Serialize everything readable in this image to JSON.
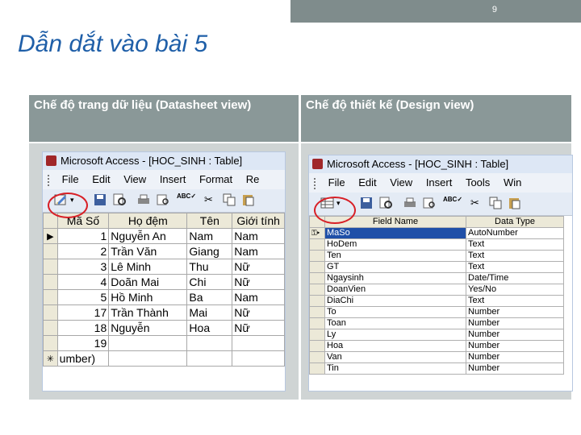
{
  "slide": {
    "number": "9",
    "title": "Dẫn dắt vào bài 5"
  },
  "columns": {
    "left_header": "Chế độ trang dữ liệu (Datasheet view)",
    "right_header": "Chế độ thiết kế (Design view)"
  },
  "datasheet_window": {
    "title": "Microsoft Access - [HOC_SINH : Table]",
    "menu": [
      "File",
      "Edit",
      "View",
      "Insert",
      "Format",
      "Re"
    ],
    "headers": [
      "Mã Số",
      "Họ đệm",
      "Tên",
      "Giới tính"
    ],
    "rows": [
      {
        "sel": "▶",
        "id": "1",
        "ho_dem": "Nguyễn An",
        "ten": "Nam",
        "gioi_tinh": "Nam"
      },
      {
        "sel": "",
        "id": "2",
        "ho_dem": "Trần Văn",
        "ten": "Giang",
        "gioi_tinh": "Nam"
      },
      {
        "sel": "",
        "id": "3",
        "ho_dem": "Lê Minh",
        "ten": "Thu",
        "gioi_tinh": "Nữ"
      },
      {
        "sel": "",
        "id": "4",
        "ho_dem": "Doãn Mai",
        "ten": "Chi",
        "gioi_tinh": "Nữ"
      },
      {
        "sel": "",
        "id": "5",
        "ho_dem": "Hồ Minh",
        "ten": "Ba",
        "gioi_tinh": "Nam"
      },
      {
        "sel": "",
        "id": "17",
        "ho_dem": "Trần Thành",
        "ten": "Mai",
        "gioi_tinh": "Nữ"
      },
      {
        "sel": "",
        "id": "18",
        "ho_dem": "Nguyễn",
        "ten": "Hoa",
        "gioi_tinh": "Nữ"
      },
      {
        "sel": "",
        "id": "19",
        "ho_dem": "",
        "ten": "",
        "gioi_tinh": ""
      },
      {
        "sel": "✳",
        "id": "umber)",
        "ho_dem": "",
        "ten": "",
        "gioi_tinh": ""
      }
    ]
  },
  "design_window": {
    "title": "Microsoft Access - [HOC_SINH : Table]",
    "menu": [
      "File",
      "Edit",
      "View",
      "Insert",
      "Tools",
      "Win"
    ],
    "headers": [
      "Field Name",
      "Data Type"
    ],
    "rows": [
      {
        "field": "MaSo",
        "type": "AutoNumber"
      },
      {
        "field": "HoDem",
        "type": "Text"
      },
      {
        "field": "Ten",
        "type": "Text"
      },
      {
        "field": "GT",
        "type": "Text"
      },
      {
        "field": "Ngaysinh",
        "type": "Date/Time"
      },
      {
        "field": "DoanVien",
        "type": "Yes/No"
      },
      {
        "field": "DiaChi",
        "type": "Text"
      },
      {
        "field": "To",
        "type": "Number"
      },
      {
        "field": "Toan",
        "type": "Number"
      },
      {
        "field": "Ly",
        "type": "Number"
      },
      {
        "field": "Hoa",
        "type": "Number"
      },
      {
        "field": "Van",
        "type": "Number"
      },
      {
        "field": "Tin",
        "type": "Number"
      }
    ]
  },
  "colors": {
    "title": "#1f5fa8",
    "header_bg": "#8a9898",
    "highlight_circle": "#d81f26"
  }
}
